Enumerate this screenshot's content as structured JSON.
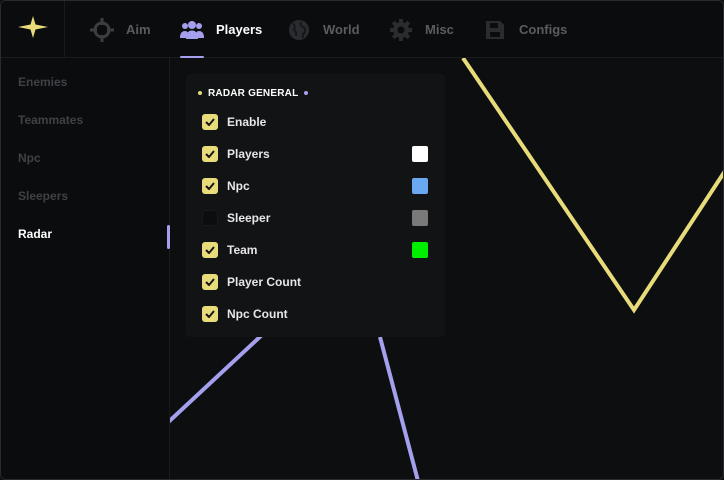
{
  "colors": {
    "accent_purple": "#a5a0ee",
    "accent_yellow": "#e8dc7a",
    "background": "#0d0e10",
    "panel": "#121315"
  },
  "topbar": {
    "logo_icon": "star-sparkle-icon",
    "tabs": [
      {
        "label": "Aim",
        "icon": "crosshair-icon",
        "active": false
      },
      {
        "label": "Players",
        "icon": "users-icon",
        "active": true
      },
      {
        "label": "World",
        "icon": "globe-icon",
        "active": false
      },
      {
        "label": "Misc",
        "icon": "gear-icon",
        "active": false
      },
      {
        "label": "Configs",
        "icon": "save-icon",
        "active": false
      }
    ]
  },
  "sidebar": {
    "items": [
      {
        "label": "Enemies",
        "active": false
      },
      {
        "label": "Teammates",
        "active": false
      },
      {
        "label": "Npc",
        "active": false
      },
      {
        "label": "Sleepers",
        "active": false
      },
      {
        "label": "Radar",
        "active": true
      }
    ]
  },
  "panel": {
    "title": "RADAR GENERAL",
    "options": [
      {
        "label": "Enable",
        "checked": true,
        "color": null
      },
      {
        "label": "Players",
        "checked": true,
        "color": "#ffffff"
      },
      {
        "label": "Npc",
        "checked": true,
        "color": "#6aa8f4"
      },
      {
        "label": "Sleeper",
        "checked": false,
        "color": "#7a7a7a"
      },
      {
        "label": "Team",
        "checked": true,
        "color": "#00ee00"
      },
      {
        "label": "Player Count",
        "checked": true,
        "color": null
      },
      {
        "label": "Npc Count",
        "checked": true,
        "color": null
      }
    ]
  }
}
